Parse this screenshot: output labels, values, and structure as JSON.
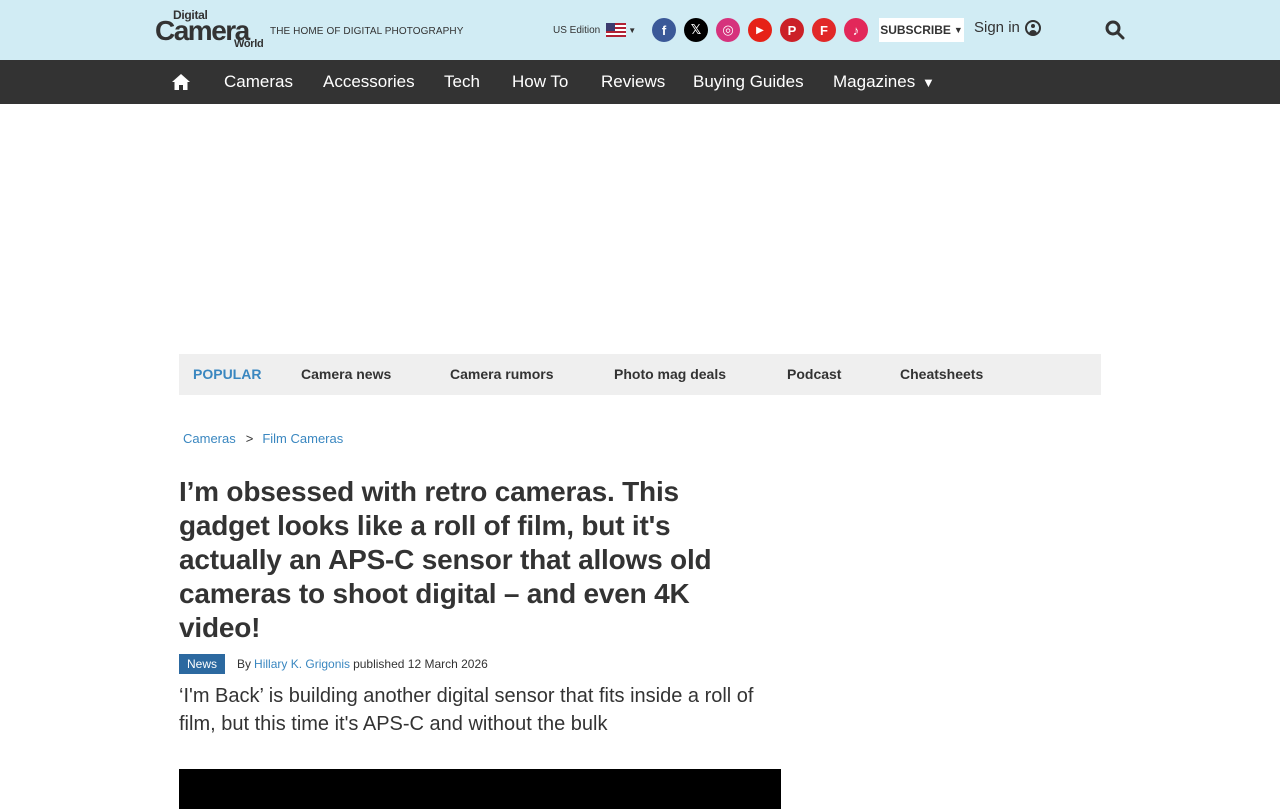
{
  "header": {
    "logo": {
      "line1": "Digital",
      "line2": "Camera",
      "line3": "World"
    },
    "tagline": "THE HOME OF DIGITAL PHOTOGRAPHY",
    "edition": "US Edition",
    "social": [
      {
        "name": "facebook-icon",
        "glyph": "f",
        "color": "#3b5998"
      },
      {
        "name": "x-icon",
        "glyph": "𝕏",
        "color": "#000000"
      },
      {
        "name": "instagram-icon",
        "glyph": "◎",
        "color": "#d6327c"
      },
      {
        "name": "youtube-icon",
        "glyph": "▶",
        "color": "#e62117"
      },
      {
        "name": "pinterest-icon",
        "glyph": "P",
        "color": "#cb2027"
      },
      {
        "name": "flipboard-icon",
        "glyph": "F",
        "color": "#e12828"
      },
      {
        "name": "tiktok-icon",
        "glyph": "♪",
        "color": "#e2285a"
      }
    ],
    "subscribe_label": "SUBSCRIBE",
    "signin_label": "Sign in"
  },
  "nav": {
    "items": [
      "Cameras",
      "Accessories",
      "Tech",
      "How To",
      "Reviews",
      "Buying Guides",
      "Magazines"
    ]
  },
  "popular": {
    "label": "POPULAR",
    "items": [
      "Camera news",
      "Camera rumors",
      "Photo mag deals",
      "Podcast",
      "Cheatsheets"
    ]
  },
  "breadcrumb": {
    "items": [
      "Cameras",
      "Film Cameras"
    ],
    "separator": ">"
  },
  "article": {
    "headline": "I’m obsessed with retro cameras. This gadget looks like a roll of film, but it's actually an APS-C sensor that allows old cameras to shoot digital – and even 4K video!",
    "tag": "News",
    "by": "By",
    "author": "Hillary K. Grigonis",
    "published": "published 12 March 2026",
    "standfirst": "‘I'm Back’ is building another digital sensor that fits inside a roll of film, but this time it's APS-C and without the bulk"
  }
}
